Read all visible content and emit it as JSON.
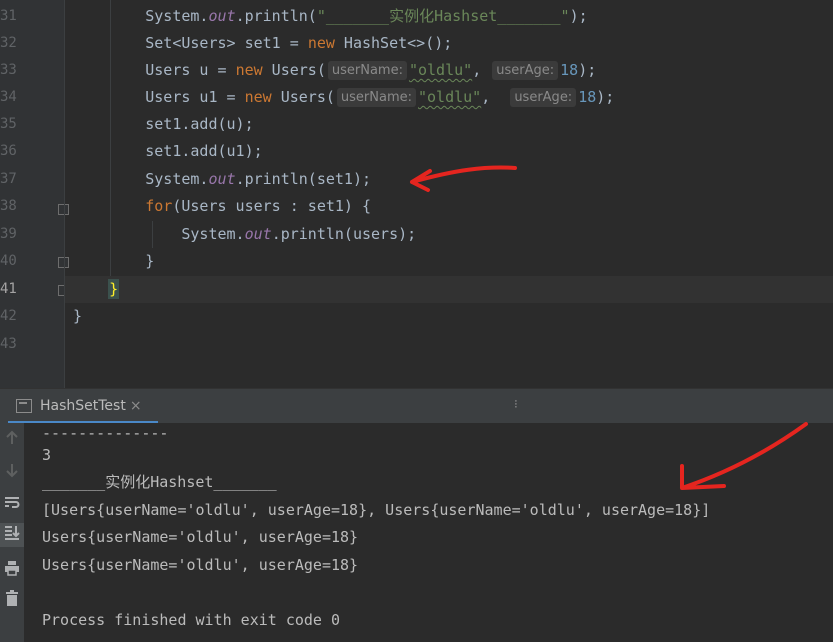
{
  "editor": {
    "line_numbers": [
      "31",
      "32",
      "33",
      "34",
      "35",
      "36",
      "37",
      "38",
      "39",
      "40",
      "41",
      "42",
      "43"
    ],
    "lines": {
      "l31": {
        "indent": "        ",
        "a": "System.",
        "field": "out",
        "b": ".println(",
        "str": "\"_______实例化Hashset_______\"",
        "c": ");"
      },
      "l32": {
        "indent": "        ",
        "a": "Set<Users> set1 = ",
        "kw": "new",
        "b": " HashSet<>();"
      },
      "l33": {
        "indent": "        ",
        "a": "Users u = ",
        "kw": "new",
        "b": " Users(",
        "hint1": "userName:",
        "str": "\"oldlu\"",
        "sep": ", ",
        "hint2": "userAge:",
        "num": "18",
        "c": ");"
      },
      "l34": {
        "indent": "        ",
        "a": "Users u1 = ",
        "kw": "new",
        "b": " Users(",
        "hint1": "userName:",
        "str": "\"oldlu\"",
        "sep": ",  ",
        "hint2": "userAge:",
        "num": "18",
        "c": ");"
      },
      "l35": {
        "indent": "        ",
        "a": "set1.add(u);"
      },
      "l36": {
        "indent": "        ",
        "a": "set1.add(u1);"
      },
      "l37": {
        "indent": "        ",
        "a": "System.",
        "field": "out",
        "b": ".println(set1);"
      },
      "l38": {
        "indent": "        ",
        "kw": "for",
        "a": "(Users users : set1) {"
      },
      "l39": {
        "indent": "            ",
        "a": "System.",
        "field": "out",
        "b": ".println(users);"
      },
      "l40": {
        "indent": "        ",
        "a": "}"
      },
      "l41": {
        "indent": "    ",
        "a": "}"
      },
      "l42": {
        "indent": "",
        "a": "}"
      }
    }
  },
  "run_panel": {
    "tab_label": "HashSetTest",
    "tab_close": "×",
    "more": "⁝",
    "icons": [
      "arrow-up-icon",
      "arrow-down-icon",
      "soft-wrap-icon",
      "scroll-to-end-icon",
      "print-icon",
      "trash-icon"
    ]
  },
  "console": {
    "lines": [
      "--------------",
      "3",
      "_______实例化Hashset_______",
      "[Users{userName='oldlu', userAge=18}, Users{userName='oldlu', userAge=18}]",
      "Users{userName='oldlu', userAge=18}",
      "Users{userName='oldlu', userAge=18}",
      "",
      "Process finished with exit code 0"
    ]
  },
  "colors": {
    "keyword": "#cc7832",
    "string": "#6a8759",
    "number": "#6897bb",
    "field": "#9876aa",
    "annotation_red": "#e5251f"
  }
}
